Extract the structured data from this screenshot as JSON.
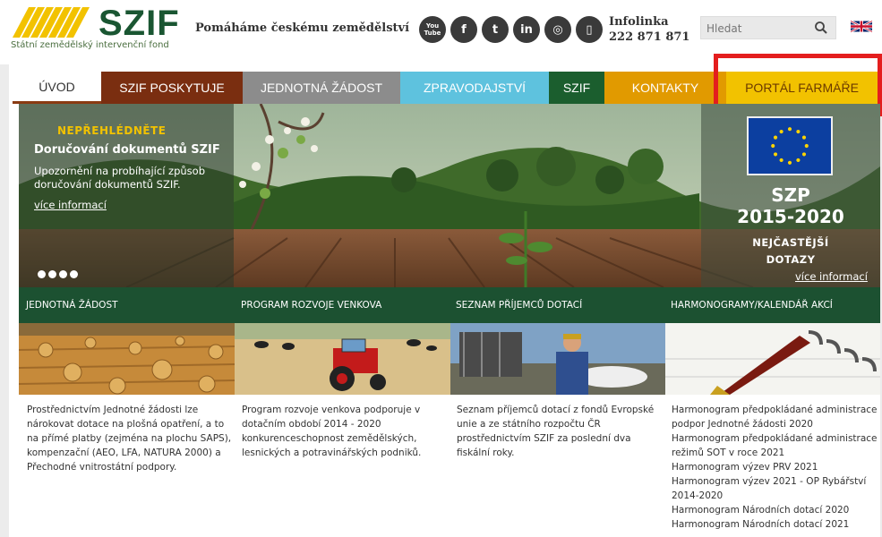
{
  "header": {
    "logo_text": "SZIF",
    "logo_sub": "Státní zemědělský intervenční fond",
    "tagline": "Pomáháme českému zemědělství",
    "social_icons": [
      "youtube-icon",
      "facebook-icon",
      "twitter-icon",
      "linkedin-icon",
      "instagram-icon",
      "mobile-icon"
    ],
    "social_glyphs": [
      "You Tube",
      "f",
      "t",
      "in",
      "◎",
      "▯"
    ],
    "infolinka_label": "Infolinka",
    "infolinka_number": "222 871 871",
    "search_placeholder": "Hledat",
    "flag": "uk-flag"
  },
  "nav": {
    "items": [
      {
        "label": "ÚVOD"
      },
      {
        "label": "SZIF POSKYTUJE"
      },
      {
        "label": "JEDNOTNÁ ŽÁDOST"
      },
      {
        "label": "ZPRAVODAJSTVÍ"
      },
      {
        "label": "SZIF"
      },
      {
        "label": "KONTAKTY"
      },
      {
        "label": "PORTÁL FARMÁŘE"
      }
    ],
    "colors": {
      "posk": "#7a2e10",
      "jedn": "#8c8c8c",
      "zprav": "#5ec2de",
      "szif": "#1b5e2e",
      "kont": "#e19a00",
      "portal": "#f2c200",
      "highlight": "#e41e1e"
    }
  },
  "hero": {
    "notice_title": "NEPŘEHLÉDNĚTE",
    "notice_head": "Doručování dokumentů SZIF",
    "notice_text": "Upozornění na probíhající způsob doručování dokumentů SZIF.",
    "notice_link": "více informací",
    "szp_title_1": "SZP",
    "szp_title_2": "2015-2020",
    "szp_faq_1": "NEJČASTĚJŠÍ",
    "szp_faq_2": "DOTAZY",
    "szp_link": "více informací"
  },
  "sections": [
    {
      "title": "JEDNOTNÁ ŽÁDOST",
      "text": "Prostřednictvím Jednotné žádosti lze nárokovat dotace na plošná opatření, a to na přímé platby (zejména na plochu SAPS), kompenzační (AEO, LFA, NATURA 2000) a Přechodné vnitrostátní podpory."
    },
    {
      "title": "PROGRAM ROZVOJE VENKOVA",
      "text": "Program rozvoje venkova podporuje v dotačním období 2014 - 2020 konkurenceschopnost zemědělských, lesnických a potravinářských podniků."
    },
    {
      "title": "SEZNAM PŘÍJEMCŮ DOTACÍ",
      "text": "Seznam příjemců dotací z fondů Evropské unie a ze státního rozpočtu ČR prostřednictvím SZIF za poslední dva fiskální roky."
    },
    {
      "title": "HARMONOGRAMY/KALENDÁŘ AKCÍ",
      "links": [
        "Harmonogram předpokládané administrace podpor Jednotné žádosti 2020",
        "Harmonogram předpokládané administrace režimů SOT v roce 2021",
        "Harmonogram výzev PRV 2021",
        "Harmonogram výzev 2021 - OP Rybářství 2014-2020",
        "Harmonogram Národních dotací 2020",
        "Harmonogram Národních dotací 2021"
      ]
    }
  ]
}
